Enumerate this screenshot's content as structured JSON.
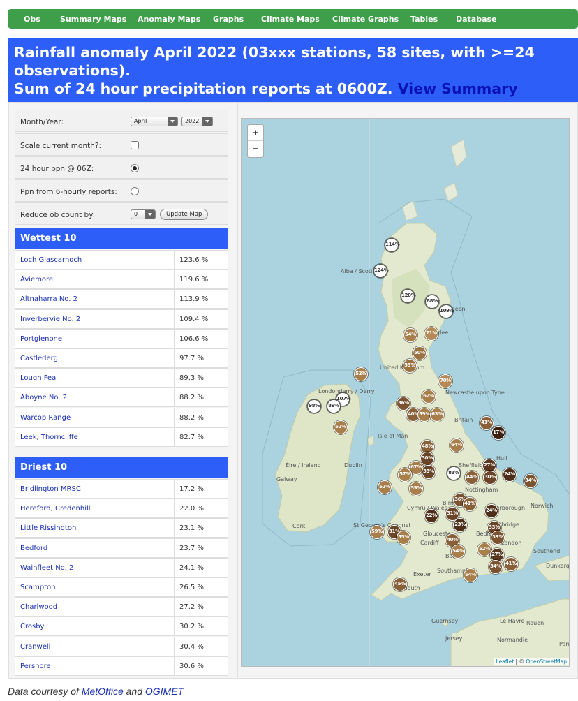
{
  "nav": [
    "Obs",
    "Summary Maps",
    "Anomaly Maps",
    "Graphs",
    "Climate Maps",
    "Climate Graphs",
    "Tables",
    "Database"
  ],
  "header": {
    "line1": "Rainfall anomaly April 2022 (03xxx stations, 58 sites, with >=24",
    "line2": "observations).",
    "line3": "Sum of 24 hour precipitation reports at 0600Z.",
    "link": "View Summary"
  },
  "form": {
    "month_year_label": "Month/Year:",
    "month_value": "April",
    "year_value": "2022",
    "scale_label": "Scale current month?:",
    "ppn24_label": "24 hour ppn @ 06Z:",
    "ppn6_label": "Ppn from 6-hourly reports:",
    "reduce_label": "Reduce ob count by:",
    "reduce_value": "0",
    "update_button": "Update Map"
  },
  "wettest": {
    "title": "Wettest 10",
    "rows": [
      {
        "name": "Loch Glascarnoch",
        "value": "123.6 %"
      },
      {
        "name": "Aviemore",
        "value": "119.6 %"
      },
      {
        "name": "Altnaharra No. 2",
        "value": "113.9 %"
      },
      {
        "name": "Inverbervie No. 2",
        "value": "109.4 %"
      },
      {
        "name": "Portglenone",
        "value": "106.6 %"
      },
      {
        "name": "Castlederg",
        "value": "97.7 %"
      },
      {
        "name": "Lough Fea",
        "value": "89.3 %"
      },
      {
        "name": "Aboyne No. 2",
        "value": "88.2 %"
      },
      {
        "name": "Warcop Range",
        "value": "88.2 %"
      },
      {
        "name": "Leek, Thorncliffe",
        "value": "82.7 %"
      }
    ]
  },
  "driest": {
    "title": "Driest 10",
    "rows": [
      {
        "name": "Bridlington MRSC",
        "value": "17.2 %"
      },
      {
        "name": "Hereford, Credenhill",
        "value": "22.0 %"
      },
      {
        "name": "Little Rissington",
        "value": "23.1 %"
      },
      {
        "name": "Bedford",
        "value": "23.7 %"
      },
      {
        "name": "Wainfleet No. 2",
        "value": "24.1 %"
      },
      {
        "name": "Scampton",
        "value": "26.5 %"
      },
      {
        "name": "Charlwood",
        "value": "27.2 %"
      },
      {
        "name": "Crosby",
        "value": "30.2 %"
      },
      {
        "name": "Cranwell",
        "value": "30.4 %"
      },
      {
        "name": "Pershore",
        "value": "30.6 %"
      }
    ]
  },
  "map": {
    "zoom_in": "+",
    "zoom_out": "−",
    "attribution_link": "Leaflet",
    "attribution_text": "| ©",
    "attribution_osm": "OpenStreetMap",
    "places": [
      "Alba / Scotland",
      "Aberdeen",
      "Dundee",
      "United Kingdom",
      "Londonderry / Derry",
      "Newcastle upon Tyne",
      "Britain",
      "Isle of Man",
      "Éire / Ireland",
      "Dublin",
      "Galway",
      "Sheffield",
      "Hull",
      "Nottingham",
      "Birmingham",
      "Peterborough",
      "Norwich",
      "Cambridge",
      "Cork",
      "Gloucester",
      "Bedford",
      "Cardiff",
      "Bath",
      "Southend",
      "London",
      "Southampton",
      "Exeter",
      "Plymouth",
      "Guernsey",
      "Jersey",
      "Le Havre",
      "Rouen",
      "Dunkerque",
      "Cymru / Wales",
      "St George's Channel",
      "Normandie",
      "Paris"
    ],
    "markers": [
      {
        "label": "114%",
        "color": "#ffffff"
      },
      {
        "label": "124%",
        "color": "#ffffff"
      },
      {
        "label": "120%",
        "color": "#ffffff"
      },
      {
        "label": "88%",
        "color": "#ffffff"
      },
      {
        "label": "109%",
        "color": "#ffffff"
      },
      {
        "label": "54%",
        "color": "#a87e4b"
      },
      {
        "label": "71%",
        "color": "#b58a56"
      },
      {
        "label": "50%",
        "color": "#9b7242"
      },
      {
        "label": "53%",
        "color": "#9b7242"
      },
      {
        "label": "52%",
        "color": "#a87e4b"
      },
      {
        "label": "70%",
        "color": "#b58a56"
      },
      {
        "label": "62%",
        "color": "#a87e4b"
      },
      {
        "label": "107%",
        "color": "#ffffff"
      },
      {
        "label": "98%",
        "color": "#ffffff"
      },
      {
        "label": "89%",
        "color": "#ffffff"
      },
      {
        "label": "36%",
        "color": "#7b5330"
      },
      {
        "label": "40%",
        "color": "#8a6038"
      },
      {
        "label": "59%",
        "color": "#a87e4b"
      },
      {
        "label": "63%",
        "color": "#a87e4b"
      },
      {
        "label": "52%",
        "color": "#a87e4b"
      },
      {
        "label": "41%",
        "color": "#8a6038"
      },
      {
        "label": "17%",
        "color": "#3d1f10"
      },
      {
        "label": "48%",
        "color": "#8a6038"
      },
      {
        "label": "64%",
        "color": "#a87e4b"
      },
      {
        "label": "30%",
        "color": "#6a4426"
      },
      {
        "label": "67%",
        "color": "#a87e4b"
      },
      {
        "label": "33%",
        "color": "#6a4426"
      },
      {
        "label": "57%",
        "color": "#a87e4b"
      },
      {
        "label": "83%",
        "color": "#ffffff"
      },
      {
        "label": "27%",
        "color": "#5a3820"
      },
      {
        "label": "30%",
        "color": "#6a4426"
      },
      {
        "label": "24%",
        "color": "#4e2e18"
      },
      {
        "label": "44%",
        "color": "#8a6038"
      },
      {
        "label": "34%",
        "color": "#7b5330"
      },
      {
        "label": "52%",
        "color": "#a87e4b"
      },
      {
        "label": "55%",
        "color": "#a87e4b"
      },
      {
        "label": "36%",
        "color": "#7b5330"
      },
      {
        "label": "41%",
        "color": "#8a6038"
      },
      {
        "label": "31%",
        "color": "#6a4426"
      },
      {
        "label": "22%",
        "color": "#4e2e18"
      },
      {
        "label": "24%",
        "color": "#4e2e18"
      },
      {
        "label": "23%",
        "color": "#4e2e18"
      },
      {
        "label": "33%",
        "color": "#6a4426"
      },
      {
        "label": "39%",
        "color": "#7b5330"
      },
      {
        "label": "59%",
        "color": "#a87e4b"
      },
      {
        "label": "31%",
        "color": "#6a4426"
      },
      {
        "label": "55%",
        "color": "#a87e4b"
      },
      {
        "label": "40%",
        "color": "#8a6038"
      },
      {
        "label": "52%",
        "color": "#a87e4b"
      },
      {
        "label": "27%",
        "color": "#5a3820"
      },
      {
        "label": "54%",
        "color": "#a87e4b"
      },
      {
        "label": "34%",
        "color": "#7b5330"
      },
      {
        "label": "41%",
        "color": "#8a6038"
      },
      {
        "label": "54%",
        "color": "#a87e4b"
      },
      {
        "label": "45%",
        "color": "#8a6038"
      }
    ]
  },
  "footer": {
    "prefix": "Data courtesy of",
    "link1": "MetOffice",
    "and": "and",
    "link2": "OGIMET"
  }
}
